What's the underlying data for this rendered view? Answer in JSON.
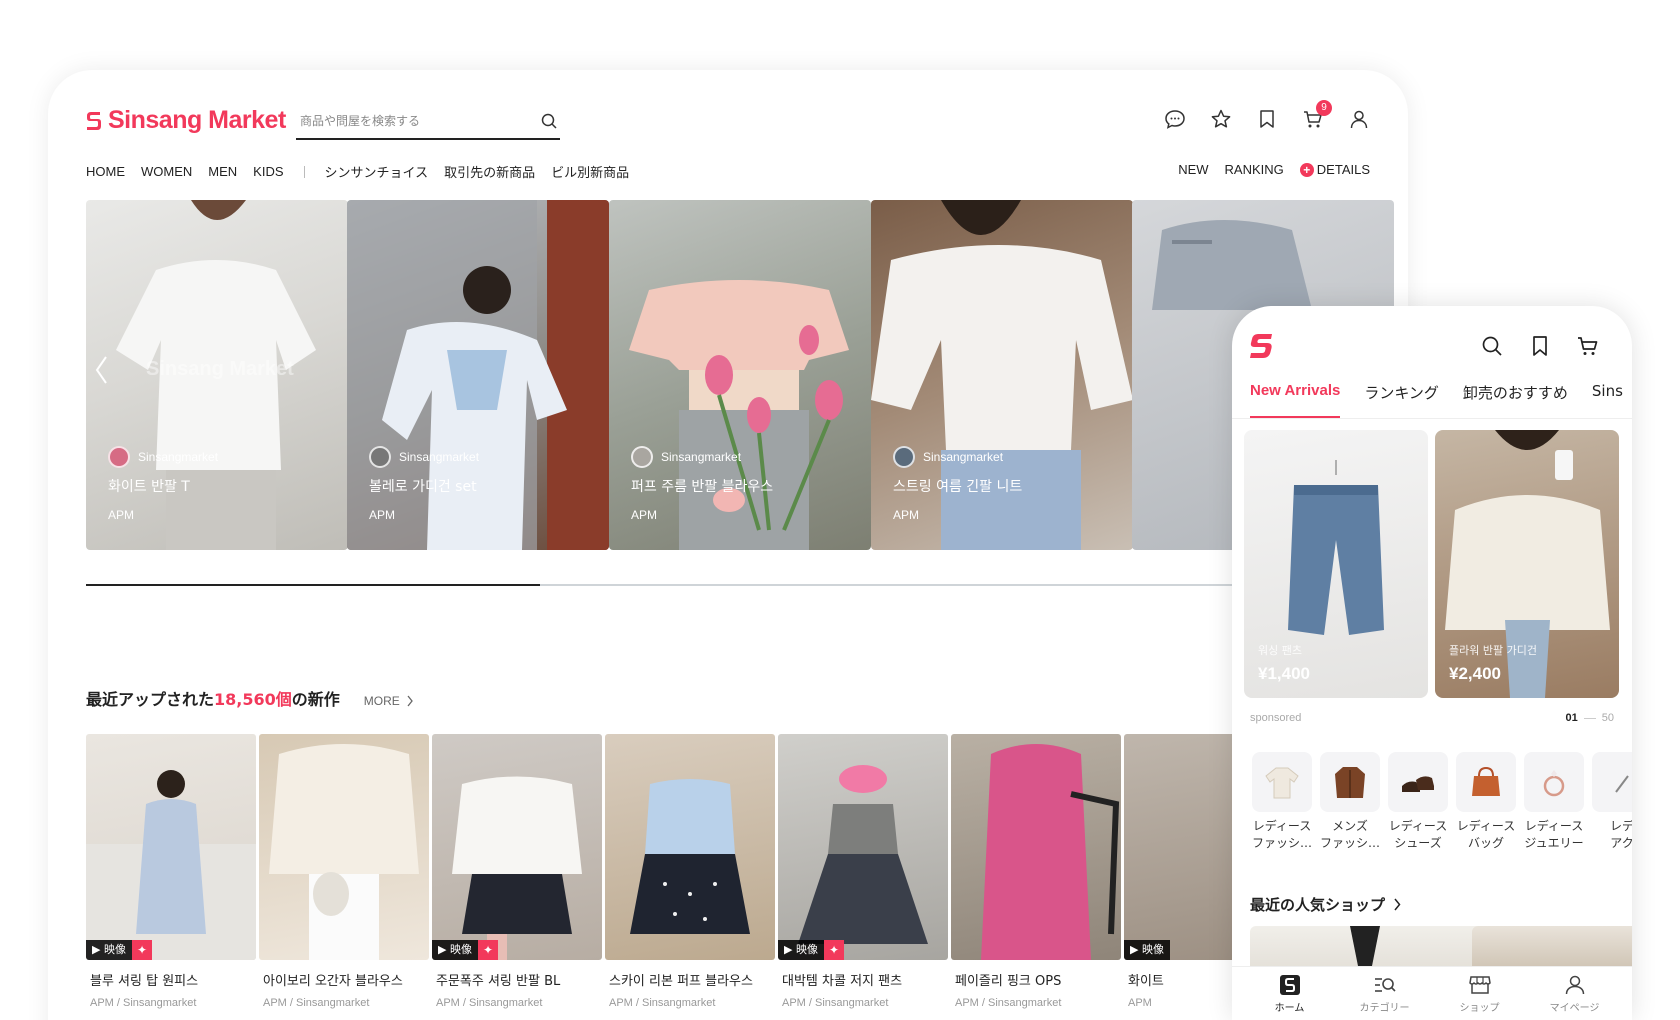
{
  "colors": {
    "accent": "#f2395b",
    "text": "#222222",
    "muted": "#999999"
  },
  "desktop": {
    "logo_text": "Sinsang Market",
    "search": {
      "placeholder": "商品や問屋を検索する"
    },
    "cart_count": "9",
    "header_icons": [
      "chat-icon",
      "star-icon",
      "bookmark-icon",
      "cart-icon",
      "user-icon"
    ],
    "nav": {
      "left": [
        "HOME",
        "WOMEN",
        "MEN",
        "KIDS"
      ],
      "left2": [
        "シンサンチョイス",
        "取引先の新商品",
        "ビル別新商品"
      ],
      "right": [
        "NEW",
        "RANKING"
      ],
      "details": "DETAILS"
    },
    "hero": {
      "watermark": "Sinsang Market",
      "items": [
        {
          "seller": "Sinsangmarket",
          "title": "화이트 반팔 T",
          "sub": "APM"
        },
        {
          "seller": "Sinsangmarket",
          "title": "볼레로 가디건 set",
          "sub": "APM"
        },
        {
          "seller": "Sinsangmarket",
          "title": "퍼프 주름 반팔 블라우스",
          "sub": "APM"
        },
        {
          "seller": "Sinsangmarket",
          "title": "스트링 여름 긴팔 니트",
          "sub": "APM"
        }
      ],
      "progress": 0.36
    },
    "section": {
      "title_pre": "最近アップされた",
      "title_num": "18,560個",
      "title_post": "の新作",
      "more": "MORE"
    },
    "grid": [
      {
        "name": "블루 셔링 탑 원피스",
        "sub": "APM / Sinsangmarket",
        "video": true
      },
      {
        "name": "아이보리 오간자 블라우스",
        "sub": "APM / Sinsangmarket",
        "video": false
      },
      {
        "name": "주문폭주 셔링 반팔 BL",
        "sub": "APM / Sinsangmarket",
        "video": true
      },
      {
        "name": "스카이 리본 퍼프 블라우스",
        "sub": "APM / Sinsangmarket",
        "video": false
      },
      {
        "name": "대박템 차콜 저지 팬츠",
        "sub": "APM / Sinsangmarket",
        "video": true
      },
      {
        "name": "페이즐리 핑크 OPS",
        "sub": "APM / Sinsangmarket",
        "video": false
      },
      {
        "name": "화이트",
        "sub": "APM",
        "video": true
      }
    ],
    "video_label": "映像"
  },
  "mobile": {
    "tabs": [
      "New Arrivals",
      "ランキング",
      "卸売のおすすめ",
      "Sins"
    ],
    "products": [
      {
        "name": "워싱 팬츠",
        "price": "¥1,400"
      },
      {
        "name": "플라워 반팔 가디건",
        "price": "¥2,400"
      }
    ],
    "sponsored": "sponsored",
    "pager": {
      "current": "01",
      "total": "50"
    },
    "categories": [
      {
        "l1": "レディース",
        "l2": "ファッシ…"
      },
      {
        "l1": "メンズ",
        "l2": "ファッシ…"
      },
      {
        "l1": "レディース",
        "l2": "シューズ"
      },
      {
        "l1": "レディース",
        "l2": "バッグ"
      },
      {
        "l1": "レディース",
        "l2": "ジュエリー"
      },
      {
        "l1": "レデ",
        "l2": "アク"
      }
    ],
    "shop_title": "最近の人気ショップ",
    "bottom_nav": [
      "ホーム",
      "カテゴリー",
      "ショップ",
      "マイページ"
    ]
  }
}
